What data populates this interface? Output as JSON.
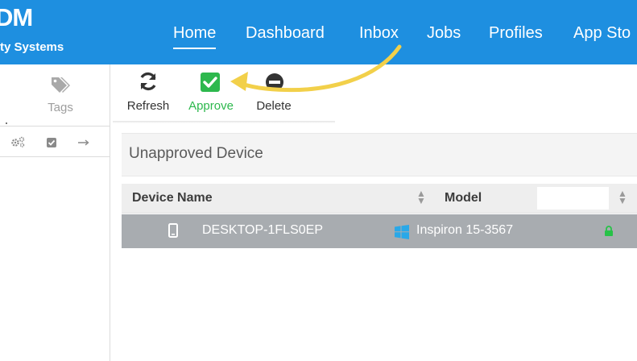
{
  "brand": {
    "name": "DM",
    "subtitle": "ty Systems"
  },
  "nav": {
    "items": [
      {
        "label": "Home",
        "active": true
      },
      {
        "label": "Dashboard",
        "active": false
      },
      {
        "label": "Inbox",
        "active": false
      },
      {
        "label": "Jobs",
        "active": false
      },
      {
        "label": "Profiles",
        "active": false
      },
      {
        "label": "App Sto",
        "active": false
      }
    ]
  },
  "sidebar": {
    "tags_label": "Tags",
    "icons": [
      "gears-icon",
      "checkbox-icon",
      "arrow-right-icon"
    ]
  },
  "toolbar": {
    "refresh_label": "Refresh",
    "approve_label": "Approve",
    "delete_label": "Delete"
  },
  "panel": {
    "title": "Unapproved Device"
  },
  "table": {
    "columns": [
      "Device Name",
      "Model"
    ],
    "filter_value": "",
    "rows": [
      {
        "device_name": "DESKTOP-1FLS0EP",
        "model": "Inspiron 15-3567",
        "status_icon": "lock-icon"
      }
    ]
  },
  "colors": {
    "topbar": "#1e8fe0",
    "approve": "#2db84d",
    "selected_row": "#a8acb0",
    "annotation_arrow": "#f2d04a"
  }
}
